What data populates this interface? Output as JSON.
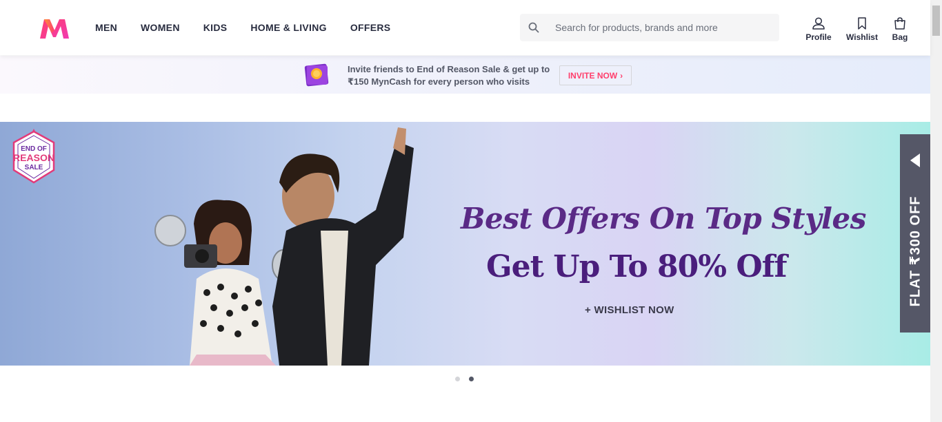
{
  "header": {
    "logo_alt": "Myntra",
    "nav": [
      {
        "label": "MEN"
      },
      {
        "label": "WOMEN"
      },
      {
        "label": "KIDS"
      },
      {
        "label": "HOME & LIVING"
      },
      {
        "label": "OFFERS"
      }
    ],
    "search": {
      "placeholder": "Search for products, brands and more",
      "value": ""
    },
    "actions": [
      {
        "label": "Profile",
        "icon": "profile-icon"
      },
      {
        "label": "Wishlist",
        "icon": "wishlist-icon"
      },
      {
        "label": "Bag",
        "icon": "bag-icon"
      }
    ]
  },
  "invite": {
    "line1": "Invite friends to End of Reason Sale & get up to",
    "line2": "₹150 MynCash for every person who visits",
    "button": "INVITE NOW"
  },
  "banner": {
    "badge_lines": [
      "END OF",
      "REASON",
      "SALE"
    ],
    "headline1": "Best Offers On Top Styles",
    "headline2": "Get Up To 80% Off",
    "cta": "+ WISHLIST NOW"
  },
  "side_tab": {
    "label": "FLAT ₹300 OFF"
  },
  "carousel": {
    "active_index": 1,
    "count": 2
  },
  "colors": {
    "brand_pink": "#ff3f6c",
    "text_dark": "#282c3f",
    "headline_purple": "#5a2a86",
    "side_tab_bg": "#555767"
  }
}
